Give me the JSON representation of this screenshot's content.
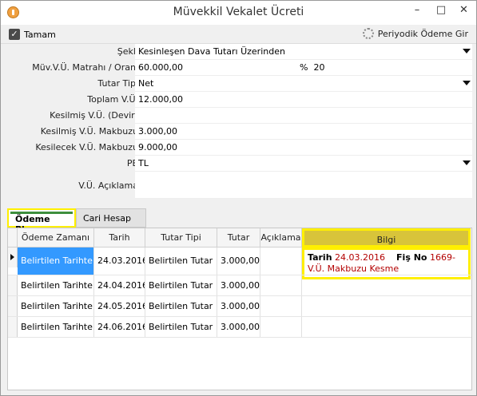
{
  "window": {
    "title": "Müvekkil Vekalet Ücreti"
  },
  "toolbar": {
    "tamam_label": "Tamam",
    "periyodik_label": "Periyodik Ödeme Gir"
  },
  "form": {
    "sekli": {
      "label": "Şekli",
      "value": "Kesinleşen Dava Tutarı Üzerinden"
    },
    "matrah": {
      "label": "Müv.V.Ü. Matrahı / Oranı",
      "value": "60.000,00",
      "pct_symbol": "%",
      "rate": "20"
    },
    "tutar_tipi": {
      "label": "Tutar Tipi",
      "value": "Net"
    },
    "toplam": {
      "label": "Toplam V.Ü.",
      "value": "12.000,00"
    },
    "kesilmis_devir": {
      "label": "Kesilmiş V.Ü. (Devir)",
      "value": ""
    },
    "kesilmis_makbuz": {
      "label": "Kesilmiş V.Ü. Makbuzu",
      "value": "3.000,00"
    },
    "kesilecek_makbuz": {
      "label": "Kesilecek V.Ü. Makbuzu",
      "value": "9.000,00"
    },
    "pb": {
      "label": "PB",
      "value": "TL"
    },
    "aciklama": {
      "label": "V.Ü. Açıklama",
      "value": ""
    }
  },
  "tabs": {
    "active": "Ödeme Planı",
    "inactive": "Cari Hesap"
  },
  "grid": {
    "headers": [
      "Ödeme Zamanı",
      "Tarih",
      "Tutar Tipi",
      "Tutar",
      "Açıklama",
      "Bilgi"
    ],
    "rows": [
      [
        "Belirtilen Tarihte",
        "24.03.2016",
        "Belirtilen Tutar",
        "3.000,00",
        ""
      ],
      [
        "Belirtilen Tarihte",
        "24.04.2016",
        "Belirtilen Tutar",
        "3.000,00",
        ""
      ],
      [
        "Belirtilen Tarihte",
        "24.05.2016",
        "Belirtilen Tutar",
        "3.000,00",
        ""
      ],
      [
        "Belirtilen Tarihte",
        "24.06.2016",
        "Belirtilen Tutar",
        "3.000,00",
        ""
      ]
    ],
    "bilgi": {
      "tarih_label": "Tarih",
      "tarih_value": "24.03.2016",
      "fis_label": "Fiş No",
      "fis_value": "1669-V.Ü. Makbuzu Kesme"
    }
  },
  "colors": {
    "highlight": "#ffef00",
    "selected_cell": "#3399ff",
    "bilgi_text": "#b30000"
  }
}
